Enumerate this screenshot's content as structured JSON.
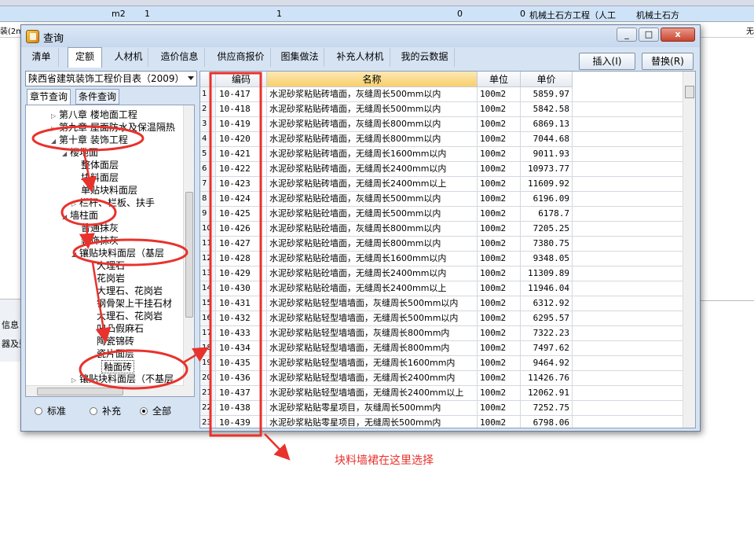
{
  "background": {
    "row1": [
      "m2",
      "1",
      "1",
      "0",
      "0",
      "机械土石方工程（人工",
      "机械土石方"
    ],
    "row2_left": "装(2m)",
    "row2_right": "无",
    "side_labels": [
      "信息",
      "器及型"
    ]
  },
  "window": {
    "title": "查询",
    "controls": [
      "_",
      "□",
      "x"
    ]
  },
  "tabs": [
    {
      "label": "清单"
    },
    {
      "label": "定额",
      "active": true
    },
    {
      "label": "人材机"
    },
    {
      "label": "造价信息"
    },
    {
      "label": "供应商报价"
    },
    {
      "label": "图集做法"
    },
    {
      "label": "补充人材机"
    },
    {
      "label": "我的云数据"
    }
  ],
  "actions": {
    "insert": "插入(I)",
    "replace": "替换(R)"
  },
  "left": {
    "library": "陕西省建筑装饰工程价目表（2009）",
    "subtabs": [
      "章节查询",
      "条件查询"
    ],
    "tree": [
      {
        "label": "第八章  楼地面工程",
        "level": 1,
        "expanded": false
      },
      {
        "label": "第九章  屋面防水及保温隔热",
        "level": 1,
        "expanded": false
      },
      {
        "label": "第十章  装饰工程",
        "level": 1,
        "expanded": true
      },
      {
        "label": "楼地面",
        "level": 2,
        "expanded": true
      },
      {
        "label": "整体面层",
        "level": 3
      },
      {
        "label": "块料面层",
        "level": 3
      },
      {
        "label": "单贴块料面层",
        "level": 3
      },
      {
        "label": "栏杆、栏板、扶手",
        "level": 3,
        "expanded": false
      },
      {
        "label": "墙柱面",
        "level": 2,
        "expanded": true
      },
      {
        "label": "普通抹灰",
        "level": 3
      },
      {
        "label": "装饰抹灰",
        "level": 3
      },
      {
        "label": "镶贴块料面层（基层",
        "level": 3,
        "expanded": true
      },
      {
        "label": "大理石",
        "level": 4
      },
      {
        "label": "花岗岩",
        "level": 4
      },
      {
        "label": "大理石、花岗岩",
        "level": 4
      },
      {
        "label": "钢骨架上干挂石材",
        "level": 4
      },
      {
        "label": "大理石、花岗岩",
        "level": 4
      },
      {
        "label": "凹凸假麻石",
        "level": 4
      },
      {
        "label": "陶瓷锦砖",
        "level": 4
      },
      {
        "label": "瓷片面层",
        "level": 4
      },
      {
        "label": "釉面砖",
        "level": 4,
        "selected": true
      },
      {
        "label": "镶贴块料面层（不基层",
        "level": 3,
        "expanded": false
      }
    ],
    "radios": [
      {
        "label": "标准",
        "checked": false
      },
      {
        "label": "补充",
        "checked": false
      },
      {
        "label": "全部",
        "checked": true
      }
    ]
  },
  "table": {
    "headers": [
      "编码",
      "名称",
      "单位",
      "单价"
    ],
    "rows": [
      {
        "idx": "1",
        "code": "10-417",
        "name": "水泥砂浆粘贴砖墙面，灰缝周长500mm以内",
        "unit": "100m2",
        "price": "5859.97"
      },
      {
        "idx": "2",
        "code": "10-418",
        "name": "水泥砂浆粘贴砖墙面，无缝周长500mm以内",
        "unit": "100m2",
        "price": "5842.58"
      },
      {
        "idx": "3",
        "code": "10-419",
        "name": "水泥砂浆粘贴砖墙面，灰缝周长800mm以内",
        "unit": "100m2",
        "price": "6869.13"
      },
      {
        "idx": "4",
        "code": "10-420",
        "name": "水泥砂浆粘贴砖墙面，无缝周长800mm以内",
        "unit": "100m2",
        "price": "7044.68"
      },
      {
        "idx": "5",
        "code": "10-421",
        "name": "水泥砂浆粘贴砖墙面，无缝周长1600mm以内",
        "unit": "100m2",
        "price": "9011.93"
      },
      {
        "idx": "6",
        "code": "10-422",
        "name": "水泥砂浆粘贴砖墙面，无缝周长2400mm以内",
        "unit": "100m2",
        "price": "10973.77"
      },
      {
        "idx": "7",
        "code": "10-423",
        "name": "水泥砂浆粘贴砖墙面，无缝周长2400mm以上",
        "unit": "100m2",
        "price": "11609.92"
      },
      {
        "idx": "8",
        "code": "10-424",
        "name": "水泥砂浆粘贴砼墙面，灰缝周长500mm以内",
        "unit": "100m2",
        "price": "6196.09"
      },
      {
        "idx": "9",
        "code": "10-425",
        "name": "水泥砂浆粘贴砼墙面，无缝周长500mm以内",
        "unit": "100m2",
        "price": "6178.7"
      },
      {
        "idx": "10",
        "code": "10-426",
        "name": "水泥砂浆粘贴砼墙面，灰缝周长800mm以内",
        "unit": "100m2",
        "price": "7205.25"
      },
      {
        "idx": "11",
        "code": "10-427",
        "name": "水泥砂浆粘贴砼墙面，无缝周长800mm以内",
        "unit": "100m2",
        "price": "7380.75"
      },
      {
        "idx": "12",
        "code": "10-428",
        "name": "水泥砂浆粘贴砼墙面，无缝周长1600mm以内",
        "unit": "100m2",
        "price": "9348.05"
      },
      {
        "idx": "13",
        "code": "10-429",
        "name": "水泥砂浆粘贴砼墙面，无缝周长2400mm以内",
        "unit": "100m2",
        "price": "11309.89"
      },
      {
        "idx": "14",
        "code": "10-430",
        "name": "水泥砂浆粘贴砼墙面，无缝周长2400mm以上",
        "unit": "100m2",
        "price": "11946.04"
      },
      {
        "idx": "15",
        "code": "10-431",
        "name": "水泥砂浆粘贴轻型墙墙面，灰缝周长500mm以内",
        "unit": "100m2",
        "price": "6312.92"
      },
      {
        "idx": "16",
        "code": "10-432",
        "name": "水泥砂浆粘贴轻型墙墙面，无缝周长500mm以内",
        "unit": "100m2",
        "price": "6295.57"
      },
      {
        "idx": "17",
        "code": "10-433",
        "name": "水泥砂浆粘贴轻型墙墙面，灰缝周长800mm内",
        "unit": "100m2",
        "price": "7322.23"
      },
      {
        "idx": "18",
        "code": "10-434",
        "name": "水泥砂浆粘贴轻型墙墙面，无缝周长800mm内",
        "unit": "100m2",
        "price": "7497.62"
      },
      {
        "idx": "19",
        "code": "10-435",
        "name": "水泥砂浆粘贴轻型墙墙面，无缝周长1600mm内",
        "unit": "100m2",
        "price": "9464.92"
      },
      {
        "idx": "20",
        "code": "10-436",
        "name": "水泥砂浆粘贴轻型墙墙面，无缝周长2400mm内",
        "unit": "100m2",
        "price": "11426.76"
      },
      {
        "idx": "21",
        "code": "10-437",
        "name": "水泥砂浆粘贴轻型墙墙面，无缝周长2400mm以上",
        "unit": "100m2",
        "price": "12062.91"
      },
      {
        "idx": "22",
        "code": "10-438",
        "name": "水泥砂浆粘贴零星项目，灰缝周长500mm内",
        "unit": "100m2",
        "price": "7252.75"
      },
      {
        "idx": "23",
        "code": "10-439",
        "name": "水泥砂浆粘贴零星项目，无缝周长500mm内",
        "unit": "100m2",
        "price": "6798.06"
      }
    ]
  },
  "annotation": {
    "text": "块料墙裙在这里选择",
    "color": "#e8322c"
  }
}
